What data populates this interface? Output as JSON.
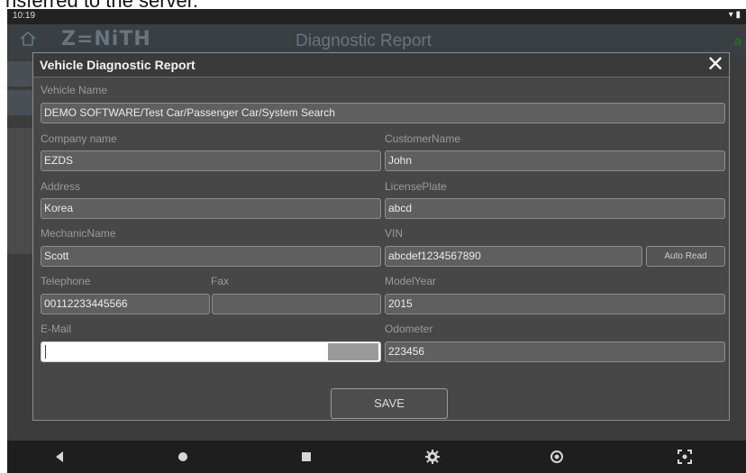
{
  "document_caption": "nsferred to the server.",
  "statusbar": {
    "time": "10:19",
    "icons": "▾ ▮"
  },
  "appbar": {
    "logo": "Z=NiTH",
    "title": "Diagnostic Report",
    "badge": "a r"
  },
  "dialog": {
    "title": "Vehicle Diagnostic Report",
    "close_label": "✕",
    "fields": {
      "vehicle_name": {
        "label": "Vehicle Name",
        "value": "DEMO SOFTWARE/Test Car/Passenger Car/System Search"
      },
      "company_name": {
        "label": "Company name",
        "value": "EZDS"
      },
      "customer_name": {
        "label": "CustomerName",
        "value": "John"
      },
      "address": {
        "label": "Address",
        "value": "Korea"
      },
      "license_plate": {
        "label": "LicensePlate",
        "value": "abcd"
      },
      "mechanic_name": {
        "label": "MechanicName",
        "value": "Scott"
      },
      "vin": {
        "label": "VIN",
        "value": "abcdef1234567890"
      },
      "telephone": {
        "label": "Telephone",
        "value": "00112233445566"
      },
      "fax": {
        "label": "Fax",
        "value": ""
      },
      "model_year": {
        "label": "ModelYear",
        "value": "2015"
      },
      "email": {
        "label": "E-Mail",
        "value": ""
      },
      "odometer": {
        "label": "Odometer",
        "value": "223456"
      }
    },
    "auto_read_label": "Auto Read",
    "save_label": "SAVE"
  },
  "navbar": {
    "icons": [
      "back-icon",
      "home-icon",
      "recents-icon",
      "settings-icon",
      "record-icon",
      "screenshot-icon"
    ]
  }
}
